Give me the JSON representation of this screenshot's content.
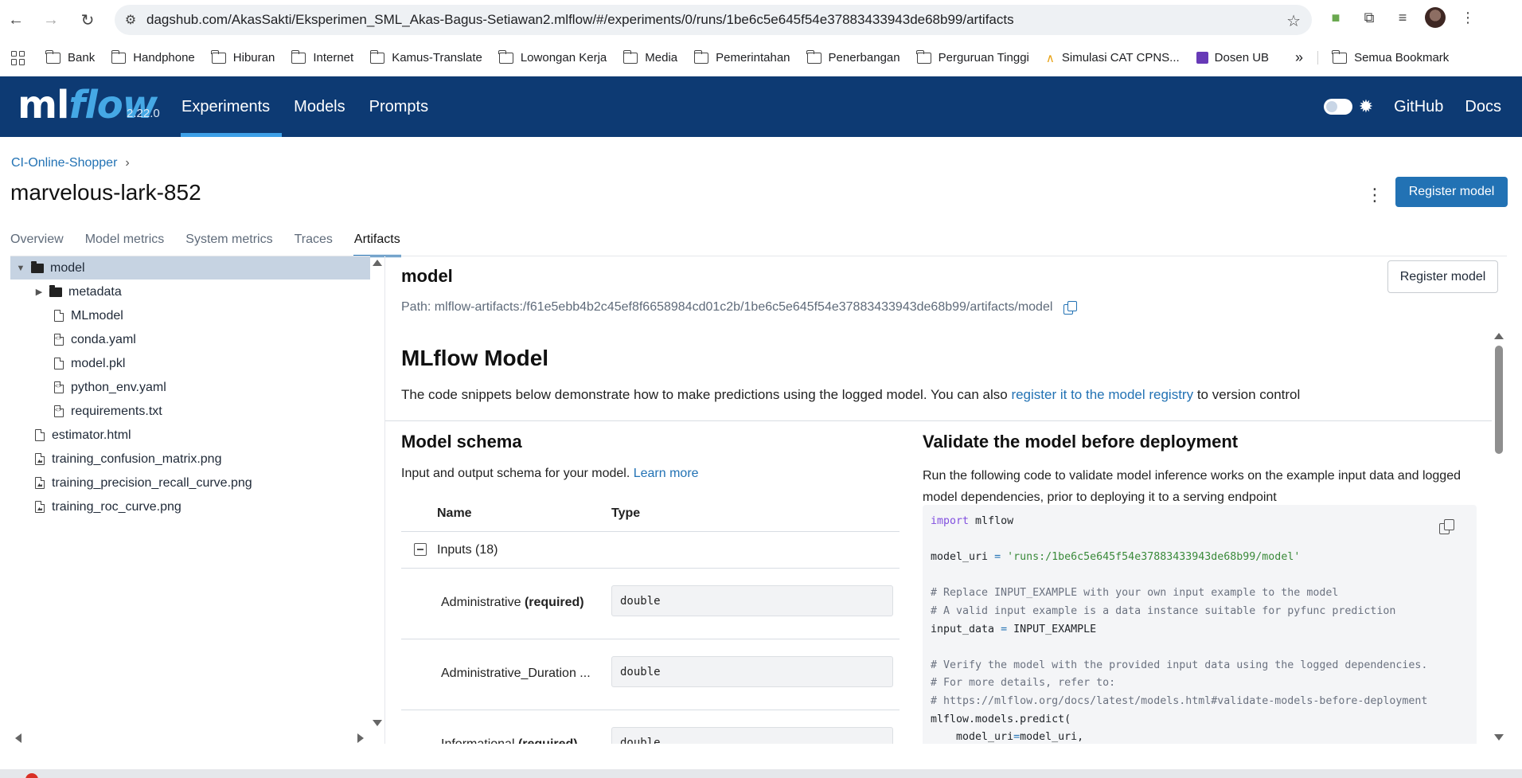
{
  "browser": {
    "url": "dagshub.com/AkasSakti/Eksperimen_SML_Akas-Bagus-Setiawan2.mlflow/#/experiments/0/runs/1be6c5e645f54e37883433943de68b99/artifacts",
    "bookmarks": [
      "Bank",
      "Handphone",
      "Hiburan",
      "Internet",
      "Kamus-Translate",
      "Lowongan Kerja",
      "Media",
      "Pemerintahan",
      "Penerbangan",
      "Perguruan Tinggi",
      "Simulasi CAT CPNS...",
      "Dosen UB"
    ],
    "overflow": "»",
    "all_bookmarks": "Semua Bookmark"
  },
  "header": {
    "logo_ml": "ml",
    "logo_flow": "flow",
    "version": "2.22.0",
    "nav": [
      "Experiments",
      "Models",
      "Prompts"
    ],
    "links": [
      "GitHub",
      "Docs"
    ]
  },
  "breadcrumb": {
    "experiment": "CI-Online-Shopper",
    "sep": "›"
  },
  "run": {
    "title": "marvelous-lark-852",
    "register_label": "Register model",
    "tabs": [
      "Overview",
      "Model metrics",
      "System metrics",
      "Traces",
      "Artifacts"
    ]
  },
  "tree": [
    {
      "label": "model",
      "kind": "folder",
      "toggle": "▼"
    },
    {
      "label": "metadata",
      "kind": "folder",
      "toggle": "▶"
    },
    {
      "label": "MLmodel",
      "kind": "file"
    },
    {
      "label": "conda.yaml",
      "kind": "code"
    },
    {
      "label": "model.pkl",
      "kind": "file"
    },
    {
      "label": "python_env.yaml",
      "kind": "code"
    },
    {
      "label": "requirements.txt",
      "kind": "code"
    },
    {
      "label": "estimator.html",
      "kind": "file"
    },
    {
      "label": "training_confusion_matrix.png",
      "kind": "image"
    },
    {
      "label": "training_precision_recall_curve.png",
      "kind": "image"
    },
    {
      "label": "training_roc_curve.png",
      "kind": "image"
    }
  ],
  "artifact": {
    "name": "model",
    "path": "Path: mlflow-artifacts:/f61e5ebb4b2c45ef8f6658984cd01c2b/1be6c5e645f54e37883433943de68b99/artifacts/model",
    "register_label": "Register model",
    "mlflow_title": "MLflow Model",
    "desc_before": "The code snippets below demonstrate how to make predictions using the logged model. You can also ",
    "desc_link": "register it to the model registry",
    "desc_after": " to version control"
  },
  "schema": {
    "title": "Model schema",
    "desc": "Input and output schema for your model. ",
    "learn_more": "Learn more",
    "col_name": "Name",
    "col_type": "Type",
    "inputs_label": "Inputs (18)",
    "required": "(required)",
    "rows": [
      {
        "name": "Administrative",
        "type": "double"
      },
      {
        "name": "Administrative_Duration ...",
        "type": "double"
      },
      {
        "name": "Informational",
        "type": "double"
      }
    ]
  },
  "validate": {
    "title": "Validate the model before deployment",
    "desc": "Run the following code to validate model inference works on the example input data and logged model dependencies, prior to deploying it to a serving endpoint",
    "code": {
      "l1_kw": "import",
      "l1_rest": " mlflow",
      "l2_var": "model_uri ",
      "l2_op": "=",
      "l2_str": " 'runs:/1be6c5e645f54e37883433943de68b99/model'",
      "c1": "# Replace INPUT_EXAMPLE with your own input example to the model",
      "c2": "# A valid input example is a data instance suitable for pyfunc prediction",
      "l3_var": "input_data ",
      "l3_op": "=",
      "l3_rest": " INPUT_EXAMPLE",
      "c3": "# Verify the model with the provided input data using the logged dependencies.",
      "c4": "# For more details, refer to:",
      "c5": "# https://mlflow.org/docs/latest/models.html#validate-models-before-deployment",
      "l4": "mlflow.models.predict(",
      "l5_a": "    model_uri",
      "l5_op": "=",
      "l5_b": "model_uri,"
    }
  }
}
